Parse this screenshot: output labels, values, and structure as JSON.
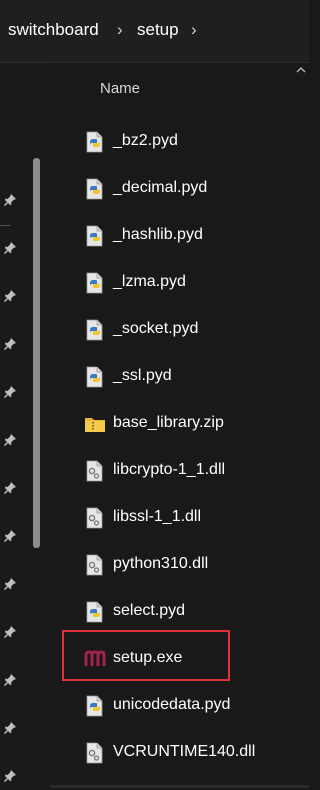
{
  "breadcrumb": {
    "items": [
      "switchboard",
      "setup"
    ],
    "separator": "›"
  },
  "file_list": {
    "column_name": "Name",
    "files": [
      {
        "name": "_bz2.pyd",
        "icon": "python-file-icon"
      },
      {
        "name": "_decimal.pyd",
        "icon": "python-file-icon"
      },
      {
        "name": "_hashlib.pyd",
        "icon": "python-file-icon"
      },
      {
        "name": "_lzma.pyd",
        "icon": "python-file-icon"
      },
      {
        "name": "_socket.pyd",
        "icon": "python-file-icon"
      },
      {
        "name": "_ssl.pyd",
        "icon": "python-file-icon"
      },
      {
        "name": "base_library.zip",
        "icon": "zip-folder-icon"
      },
      {
        "name": "libcrypto-1_1.dll",
        "icon": "dll-file-icon"
      },
      {
        "name": "libssl-1_1.dll",
        "icon": "dll-file-icon"
      },
      {
        "name": "python310.dll",
        "icon": "dll-file-icon"
      },
      {
        "name": "select.pyd",
        "icon": "python-file-icon"
      },
      {
        "name": "setup.exe",
        "icon": "exe-app-icon",
        "highlighted": true
      },
      {
        "name": "unicodedata.pyd",
        "icon": "python-file-icon"
      },
      {
        "name": "VCRUNTIME140.dll",
        "icon": "dll-file-icon"
      }
    ]
  },
  "colors": {
    "background": "#191919",
    "highlight_border": "#e0303a",
    "exe_icon": "#a3234a"
  }
}
